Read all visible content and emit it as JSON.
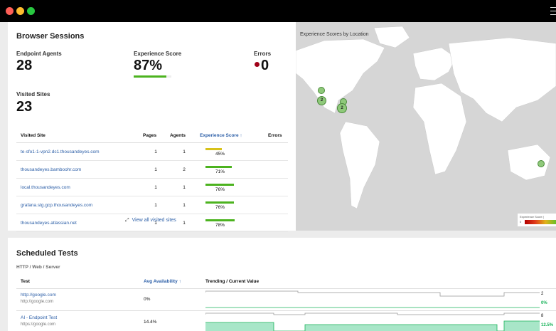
{
  "browser_sessions": {
    "title": "Browser Sessions",
    "endpoint_agents_label": "Endpoint Agents",
    "endpoint_agents_value": "28",
    "experience_score_label": "Experience Score",
    "experience_score_value": "87%",
    "experience_score_fraction": 0.87,
    "errors_label": "Errors",
    "errors_value": "0",
    "visited_sites_label": "Visited Sites",
    "visited_sites_value": "23",
    "columns": [
      "Visited Site",
      "Pages",
      "Agents",
      "Experience Score",
      "Errors"
    ],
    "sort_arrow": "↑",
    "rows": [
      {
        "site": "te-sfo1-1-vpn2.dc1.thousandeyes.com",
        "pages": "1",
        "agents": "1",
        "score": "45%",
        "score_fraction": 0.45,
        "color": "#d8c21a"
      },
      {
        "site": "thousandeyes.bamboohr.com",
        "pages": "1",
        "agents": "2",
        "score": "71%",
        "score_fraction": 0.71,
        "color": "#4cb31f"
      },
      {
        "site": "local.thousandeyes.com",
        "pages": "1",
        "agents": "1",
        "score": "76%",
        "score_fraction": 0.76,
        "color": "#4cb31f"
      },
      {
        "site": "grafana.stg.gcp.thousandeyes.com",
        "pages": "1",
        "agents": "1",
        "score": "76%",
        "score_fraction": 0.76,
        "color": "#4cb31f"
      },
      {
        "site": "thousandeyes.atlassian.net",
        "pages": "1",
        "agents": "1",
        "score": "78%",
        "score_fraction": 0.78,
        "color": "#4cb31f"
      }
    ],
    "view_all": "View all visited sites"
  },
  "map": {
    "title": "Experience Scores by Location",
    "markers": [
      "2",
      "2"
    ],
    "legend_title": "Experience Score (",
    "legend_min": "0"
  },
  "scheduled_tests": {
    "title": "Scheduled Tests",
    "subtitle": "HTTP / Web / Server",
    "col_test": "Test",
    "col_availability": "Avg Availability",
    "sort_arrow": "↑",
    "col_trending": "Trending / Current Value",
    "rows": [
      {
        "name": "http://google.com",
        "url": "http://google.com",
        "availability": "0%",
        "count": "2",
        "current": "0%"
      },
      {
        "name": "AI - Endpoint Test",
        "url": "https://google.com",
        "availability": "14.4%",
        "count": "8",
        "current": "12.5%"
      }
    ]
  },
  "colors": {
    "accent": "#2b5ea7",
    "good": "#4cb31f",
    "error_dot": "#a00018",
    "trend_green": "#19b35a"
  }
}
